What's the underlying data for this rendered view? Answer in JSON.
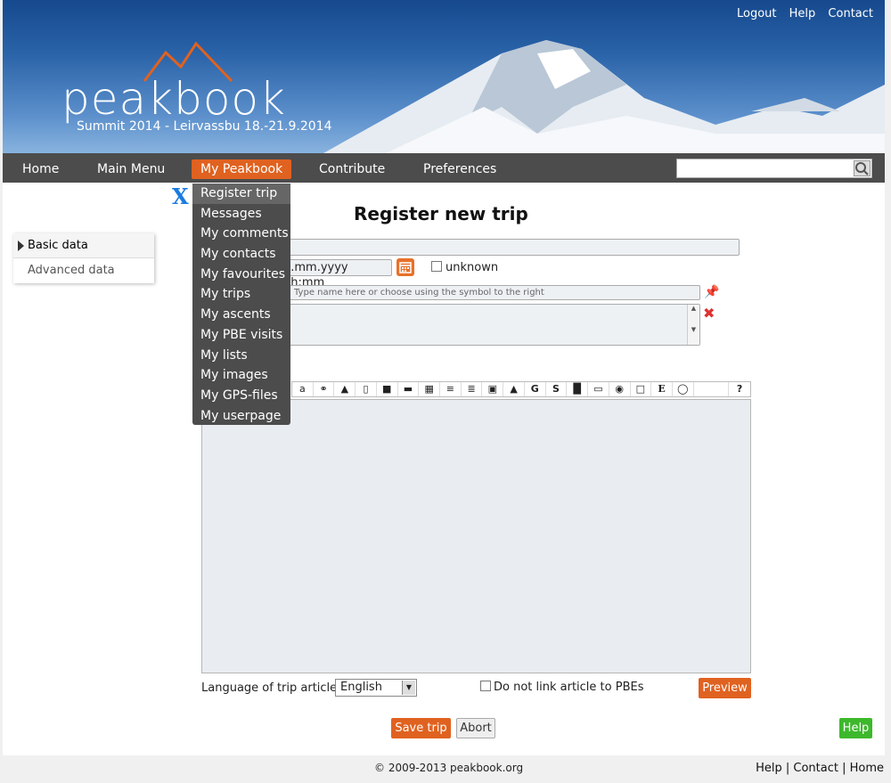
{
  "header": {
    "toplinks": [
      "Logout",
      "Help",
      "Contact"
    ],
    "logo_text": "peakbook",
    "logo_subtitle": "Summit 2014 - Leirvassbu 18.-21.9.2014"
  },
  "nav": {
    "items": [
      "Home",
      "Main Menu",
      "My Peakbook",
      "Contribute",
      "Preferences"
    ],
    "active": "My Peakbook",
    "search_placeholder": ""
  },
  "dropdown": {
    "items": [
      "Register trip",
      "Messages",
      "My comments",
      "My contacts",
      "My favourites",
      "My trips",
      "My ascents",
      "My PBE visits",
      "My lists",
      "My images",
      "My GPS-files",
      "My userpage"
    ],
    "highlighted": "Register trip",
    "close_label": "X"
  },
  "sidebar": {
    "items": [
      "Basic data",
      "Advanced data"
    ],
    "selected": "Basic data"
  },
  "form": {
    "title": "Register new trip",
    "date_placeholder": "d.mm.yyyy hh:mm",
    "unknown_label": "unknown",
    "peak_placeholder": "Type name here or choose using the symbol to the right",
    "language_label": "Language of trip article",
    "language_value": "English",
    "nolink_label": "Do not link article to PBEs",
    "preview_label": "Preview",
    "save_label": "Save trip",
    "abort_label": "Abort",
    "help_label": "Help"
  },
  "toolbar": [
    "a",
    "link",
    "mtn",
    "doc",
    "boot",
    "hr",
    "grid",
    "ul",
    "ol",
    "img",
    "up",
    "G",
    "S",
    "blk",
    "box",
    "pill",
    "page",
    "E",
    "globe",
    "",
    "?"
  ],
  "footer": {
    "copyright": "© 2009-2013 peakbook.org",
    "links": [
      "Help",
      "Contact",
      "Home"
    ]
  },
  "colors": {
    "accent": "#e06220",
    "nav_bg": "#4c4c4c",
    "help_green": "#3db82c"
  }
}
